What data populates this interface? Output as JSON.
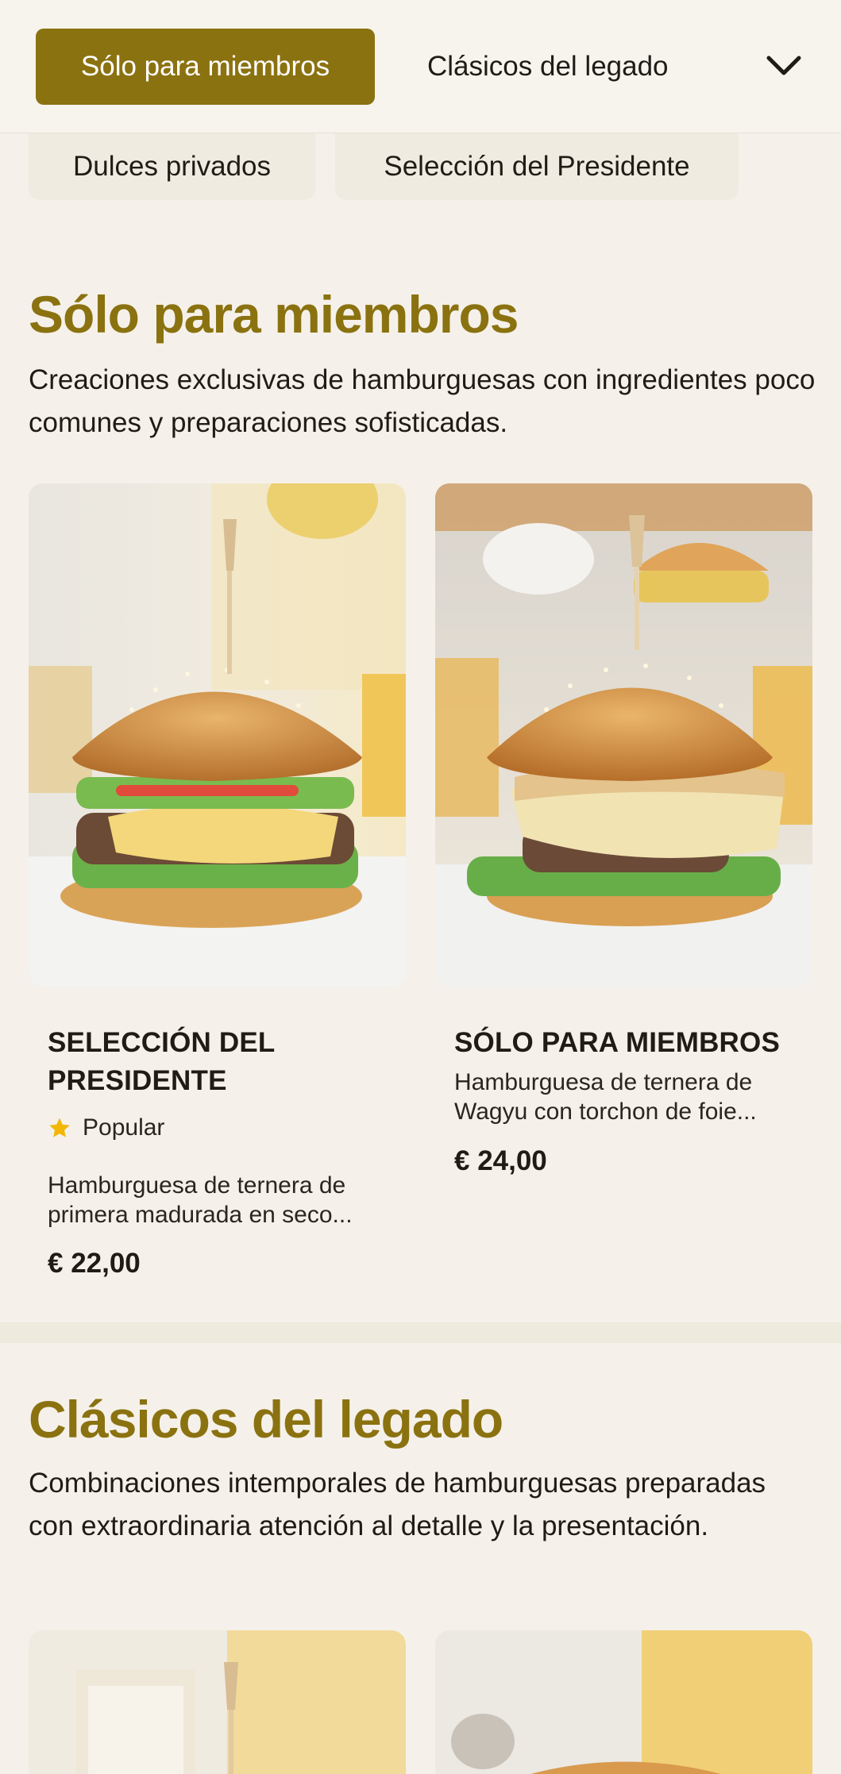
{
  "nav": {
    "active_tab": "Sólo para miembros",
    "tab_2": "Clásicos del legado",
    "chip_1": "Dulces privados",
    "chip_2": "Selección del Presidente"
  },
  "section1": {
    "title": "Sólo para miembros",
    "description": "Creaciones exclusivas de hamburguesas con ingredientes poco comunes y preparaciones sofisticadas.",
    "items": [
      {
        "name": "SELECCIÓN DEL PRESIDENTE",
        "badge": "Popular",
        "description": "Hamburguesa de ternera de primera madurada en seco...",
        "price": "€ 22,00"
      },
      {
        "name": "SÓLO PARA MIEMBROS",
        "description": "Hamburguesa de ternera de Wagyu con torchon de foie...",
        "price": "€ 24,00"
      }
    ]
  },
  "section2": {
    "title": "Clásicos del legado",
    "description": "Combinaciones intemporales de hamburguesas preparadas con extraordinaria atención al detalle y la presentación."
  },
  "colors": {
    "accent": "#8b7210",
    "background": "#f5f1ea",
    "star": "#f2b705"
  },
  "icons": {
    "chevron": "chevron-down-icon",
    "star": "star-icon"
  }
}
